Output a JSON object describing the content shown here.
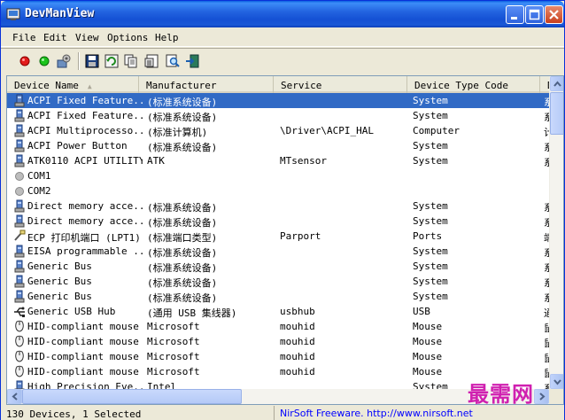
{
  "window": {
    "title": "DevManView"
  },
  "menu": [
    "File",
    "Edit",
    "View",
    "Options",
    "Help"
  ],
  "toolbar": {
    "buttons": [
      "red-dot-icon",
      "green-dot-icon",
      "properties-icon",
      "save-icon",
      "refresh-icon",
      "copy-icon",
      "html-report-icon",
      "find-icon",
      "exit-icon"
    ]
  },
  "columns": [
    "Device Name",
    "Manufacturer",
    "Service",
    "Device Type Code",
    "D"
  ],
  "rows": [
    {
      "name": "ACPI Fixed Feature...",
      "manufacturer": "(标准系统设备)",
      "service": "",
      "type": "System",
      "extra": "系",
      "icon": "device",
      "selected": true
    },
    {
      "name": "ACPI Fixed Feature...",
      "manufacturer": "(标准系统设备)",
      "service": "",
      "type": "System",
      "extra": "系",
      "icon": "device"
    },
    {
      "name": "ACPI Multiprocesso...",
      "manufacturer": "(标准计算机)",
      "service": "\\Driver\\ACPI_HAL",
      "type": "Computer",
      "extra": "计",
      "icon": "device"
    },
    {
      "name": "ACPI Power Button",
      "manufacturer": "(标准系统设备)",
      "service": "",
      "type": "System",
      "extra": "系",
      "icon": "device"
    },
    {
      "name": "ATK0110 ACPI UTILITY",
      "manufacturer": "ATK",
      "service": "MTsensor",
      "type": "System",
      "extra": "系",
      "icon": "device"
    },
    {
      "name": "COM1",
      "manufacturer": "",
      "service": "",
      "type": "",
      "extra": "",
      "icon": "gray"
    },
    {
      "name": "COM2",
      "manufacturer": "",
      "service": "",
      "type": "",
      "extra": "",
      "icon": "gray"
    },
    {
      "name": "Direct memory acce...",
      "manufacturer": "(标准系统设备)",
      "service": "",
      "type": "System",
      "extra": "系",
      "icon": "device"
    },
    {
      "name": "Direct memory acce...",
      "manufacturer": "(标准系统设备)",
      "service": "",
      "type": "System",
      "extra": "系",
      "icon": "device"
    },
    {
      "name": "ECP 打印机端口 (LPT1)",
      "manufacturer": "(标准端口类型)",
      "service": "Parport",
      "type": "Ports",
      "extra": "端",
      "icon": "port"
    },
    {
      "name": "EISA programmable ...",
      "manufacturer": "(标准系统设备)",
      "service": "",
      "type": "System",
      "extra": "系",
      "icon": "device"
    },
    {
      "name": "Generic Bus",
      "manufacturer": "(标准系统设备)",
      "service": "",
      "type": "System",
      "extra": "系",
      "icon": "device"
    },
    {
      "name": "Generic Bus",
      "manufacturer": "(标准系统设备)",
      "service": "",
      "type": "System",
      "extra": "系",
      "icon": "device"
    },
    {
      "name": "Generic Bus",
      "manufacturer": "(标准系统设备)",
      "service": "",
      "type": "System",
      "extra": "系",
      "icon": "device"
    },
    {
      "name": "Generic USB Hub",
      "manufacturer": "(通用 USB 集线器)",
      "service": "usbhub",
      "type": "USB",
      "extra": "通",
      "icon": "usb"
    },
    {
      "name": "HID-compliant mouse",
      "manufacturer": "Microsoft",
      "service": "mouhid",
      "type": "Mouse",
      "extra": "鼠",
      "icon": "mouse"
    },
    {
      "name": "HID-compliant mouse",
      "manufacturer": "Microsoft",
      "service": "mouhid",
      "type": "Mouse",
      "extra": "鼠",
      "icon": "mouse"
    },
    {
      "name": "HID-compliant mouse",
      "manufacturer": "Microsoft",
      "service": "mouhid",
      "type": "Mouse",
      "extra": "鼠",
      "icon": "mouse"
    },
    {
      "name": "HID-compliant mouse",
      "manufacturer": "Microsoft",
      "service": "mouhid",
      "type": "Mouse",
      "extra": "鼠",
      "icon": "mouse"
    },
    {
      "name": "High Precision Eve...",
      "manufacturer": "Intel",
      "service": "",
      "type": "System",
      "extra": "系",
      "icon": "device"
    }
  ],
  "status": {
    "count": "130 Devices, 1 Selected",
    "credit": "NirSoft Freeware.  http://www.nirsoft.net"
  },
  "watermark": "最需网",
  "colors": {
    "selection": "#316AC5",
    "titlebar": "#0A5FE0",
    "link": "#0000FF"
  }
}
